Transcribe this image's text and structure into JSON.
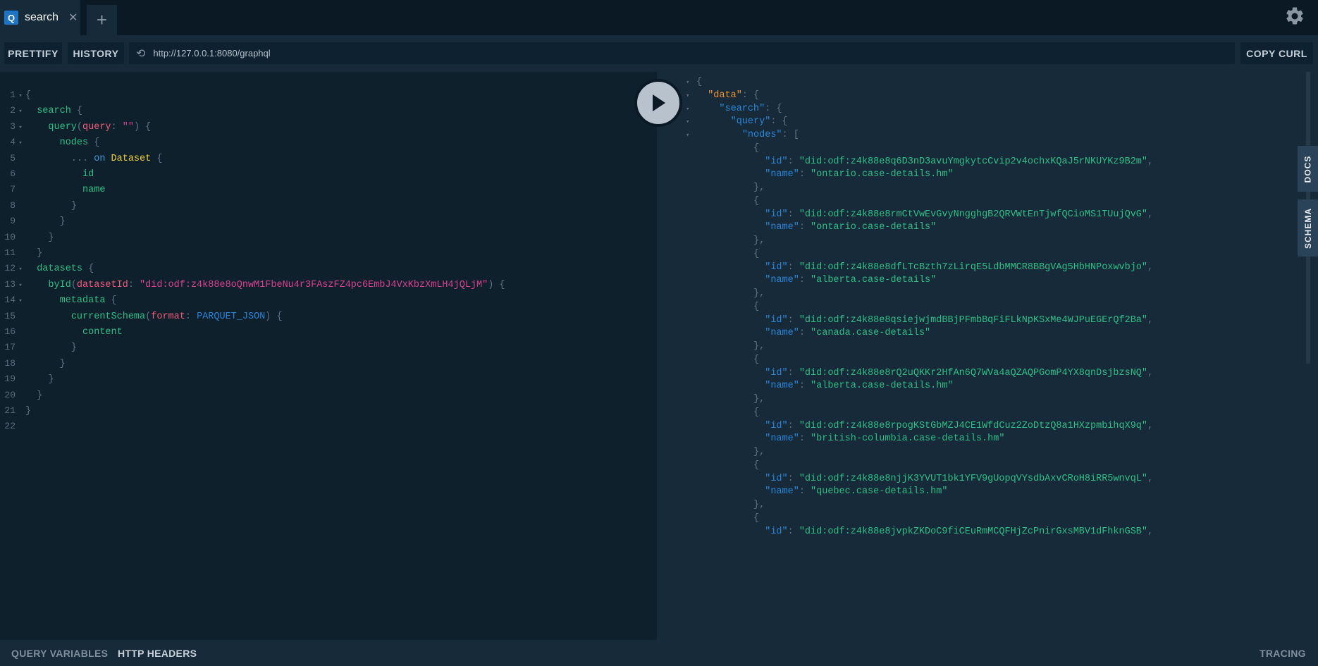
{
  "tabs": [
    {
      "icon_letter": "Q",
      "title": "search"
    }
  ],
  "toolbar": {
    "prettify": "PRETTIFY",
    "history": "HISTORY",
    "url": "http://127.0.0.1:8080/graphql",
    "copy_curl": "COPY CURL"
  },
  "side_tabs": {
    "docs": "DOCS",
    "schema": "SCHEMA"
  },
  "footer": {
    "query_variables": "QUERY VARIABLES",
    "http_headers": "HTTP HEADERS",
    "tracing": "TRACING"
  },
  "query_lines": [
    {
      "n": "1",
      "fold": true,
      "tokens": [
        [
          "p",
          "{"
        ]
      ]
    },
    {
      "n": "2",
      "fold": true,
      "tokens": [
        [
          "sp",
          "  "
        ],
        [
          "f",
          "search"
        ],
        [
          "p",
          " {"
        ]
      ]
    },
    {
      "n": "3",
      "fold": true,
      "tokens": [
        [
          "sp",
          "    "
        ],
        [
          "f",
          "query"
        ],
        [
          "p",
          "("
        ],
        [
          "a",
          "query"
        ],
        [
          "p",
          ": "
        ],
        [
          "s",
          "\"\""
        ],
        [
          "p",
          ") {"
        ]
      ]
    },
    {
      "n": "4",
      "fold": true,
      "tokens": [
        [
          "sp",
          "      "
        ],
        [
          "f",
          "nodes"
        ],
        [
          "p",
          " {"
        ]
      ]
    },
    {
      "n": "5",
      "fold": false,
      "tokens": [
        [
          "sp",
          "        "
        ],
        [
          "p",
          "... "
        ],
        [
          "k",
          "on"
        ],
        [
          "p",
          " "
        ],
        [
          "t",
          "Dataset"
        ],
        [
          "p",
          " {"
        ]
      ]
    },
    {
      "n": "6",
      "fold": false,
      "tokens": [
        [
          "sp",
          "          "
        ],
        [
          "f",
          "id"
        ]
      ]
    },
    {
      "n": "7",
      "fold": false,
      "tokens": [
        [
          "sp",
          "          "
        ],
        [
          "f",
          "name"
        ]
      ]
    },
    {
      "n": "8",
      "fold": false,
      "tokens": [
        [
          "sp",
          "        "
        ],
        [
          "p",
          "}"
        ]
      ]
    },
    {
      "n": "9",
      "fold": false,
      "tokens": [
        [
          "sp",
          "      "
        ],
        [
          "p",
          "}"
        ]
      ]
    },
    {
      "n": "10",
      "fold": false,
      "tokens": [
        [
          "sp",
          "    "
        ],
        [
          "p",
          "}"
        ]
      ]
    },
    {
      "n": "11",
      "fold": false,
      "tokens": [
        [
          "sp",
          "  "
        ],
        [
          "p",
          "}"
        ]
      ]
    },
    {
      "n": "12",
      "fold": true,
      "tokens": [
        [
          "sp",
          "  "
        ],
        [
          "f",
          "datasets"
        ],
        [
          "p",
          " {"
        ]
      ]
    },
    {
      "n": "13",
      "fold": true,
      "tokens": [
        [
          "sp",
          "    "
        ],
        [
          "f",
          "byId"
        ],
        [
          "p",
          "("
        ],
        [
          "a",
          "datasetId"
        ],
        [
          "p",
          ": "
        ],
        [
          "s",
          "\"did:odf:z4k88e8oQnwM1FbeNu4r3FAszFZ4pc6EmbJ4VxKbzXmLH4jQLjM\""
        ],
        [
          "p",
          ") {"
        ]
      ]
    },
    {
      "n": "14",
      "fold": true,
      "tokens": [
        [
          "sp",
          "      "
        ],
        [
          "f",
          "metadata"
        ],
        [
          "p",
          " {"
        ]
      ]
    },
    {
      "n": "15",
      "fold": false,
      "tokens": [
        [
          "sp",
          "        "
        ],
        [
          "f",
          "currentSchema"
        ],
        [
          "p",
          "("
        ],
        [
          "a",
          "format"
        ],
        [
          "p",
          ": "
        ],
        [
          "e",
          "PARQUET_JSON"
        ],
        [
          "p",
          ") {"
        ]
      ]
    },
    {
      "n": "16",
      "fold": false,
      "tokens": [
        [
          "sp",
          "          "
        ],
        [
          "f",
          "content"
        ]
      ]
    },
    {
      "n": "17",
      "fold": false,
      "tokens": [
        [
          "sp",
          "        "
        ],
        [
          "p",
          "}"
        ]
      ]
    },
    {
      "n": "18",
      "fold": false,
      "tokens": [
        [
          "sp",
          "      "
        ],
        [
          "p",
          "}"
        ]
      ]
    },
    {
      "n": "19",
      "fold": false,
      "tokens": [
        [
          "sp",
          "    "
        ],
        [
          "p",
          "}"
        ]
      ]
    },
    {
      "n": "20",
      "fold": false,
      "tokens": [
        [
          "sp",
          "  "
        ],
        [
          "p",
          "}"
        ]
      ]
    },
    {
      "n": "21",
      "fold": false,
      "tokens": [
        [
          "p",
          "}"
        ]
      ]
    },
    {
      "n": "22",
      "fold": false,
      "tokens": []
    }
  ],
  "result_lines": [
    {
      "fold": true,
      "tokens": [
        [
          "p",
          "{"
        ]
      ]
    },
    {
      "fold": true,
      "tokens": [
        [
          "sp",
          "  "
        ],
        [
          "dkey",
          "\"data\""
        ],
        [
          "p",
          ": {"
        ]
      ]
    },
    {
      "fold": true,
      "tokens": [
        [
          "sp",
          "    "
        ],
        [
          "key",
          "\"search\""
        ],
        [
          "p",
          ": {"
        ]
      ]
    },
    {
      "fold": true,
      "tokens": [
        [
          "sp",
          "      "
        ],
        [
          "key",
          "\"query\""
        ],
        [
          "p",
          ": {"
        ]
      ]
    },
    {
      "fold": true,
      "tokens": [
        [
          "sp",
          "        "
        ],
        [
          "key",
          "\"nodes\""
        ],
        [
          "p",
          ": ["
        ]
      ]
    },
    {
      "fold": false,
      "tokens": [
        [
          "sp",
          "          "
        ],
        [
          "p",
          "{"
        ]
      ]
    },
    {
      "fold": false,
      "tokens": [
        [
          "sp",
          "            "
        ],
        [
          "key",
          "\"id\""
        ],
        [
          "p",
          ": "
        ],
        [
          "str",
          "\"did:odf:z4k88e8q6D3nD3avuYmgkytcCvip2v4ochxKQaJ5rNKUYKz9B2m\""
        ],
        [
          "p",
          ","
        ]
      ]
    },
    {
      "fold": false,
      "tokens": [
        [
          "sp",
          "            "
        ],
        [
          "key",
          "\"name\""
        ],
        [
          "p",
          ": "
        ],
        [
          "str",
          "\"ontario.case-details.hm\""
        ]
      ]
    },
    {
      "fold": false,
      "tokens": [
        [
          "sp",
          "          "
        ],
        [
          "p",
          "},"
        ]
      ]
    },
    {
      "fold": false,
      "tokens": [
        [
          "sp",
          "          "
        ],
        [
          "p",
          "{"
        ]
      ]
    },
    {
      "fold": false,
      "tokens": [
        [
          "sp",
          "            "
        ],
        [
          "key",
          "\"id\""
        ],
        [
          "p",
          ": "
        ],
        [
          "str",
          "\"did:odf:z4k88e8rmCtVwEvGvyNngghgB2QRVWtEnTjwfQCioMS1TUujQvG\""
        ],
        [
          "p",
          ","
        ]
      ]
    },
    {
      "fold": false,
      "tokens": [
        [
          "sp",
          "            "
        ],
        [
          "key",
          "\"name\""
        ],
        [
          "p",
          ": "
        ],
        [
          "str",
          "\"ontario.case-details\""
        ]
      ]
    },
    {
      "fold": false,
      "tokens": [
        [
          "sp",
          "          "
        ],
        [
          "p",
          "},"
        ]
      ]
    },
    {
      "fold": false,
      "tokens": [
        [
          "sp",
          "          "
        ],
        [
          "p",
          "{"
        ]
      ]
    },
    {
      "fold": false,
      "tokens": [
        [
          "sp",
          "            "
        ],
        [
          "key",
          "\"id\""
        ],
        [
          "p",
          ": "
        ],
        [
          "str",
          "\"did:odf:z4k88e8dfLTcBzth7zLirqE5LdbMMCR8BBgVAg5HbHNPoxwvbjo\""
        ],
        [
          "p",
          ","
        ]
      ]
    },
    {
      "fold": false,
      "tokens": [
        [
          "sp",
          "            "
        ],
        [
          "key",
          "\"name\""
        ],
        [
          "p",
          ": "
        ],
        [
          "str",
          "\"alberta.case-details\""
        ]
      ]
    },
    {
      "fold": false,
      "tokens": [
        [
          "sp",
          "          "
        ],
        [
          "p",
          "},"
        ]
      ]
    },
    {
      "fold": false,
      "tokens": [
        [
          "sp",
          "          "
        ],
        [
          "p",
          "{"
        ]
      ]
    },
    {
      "fold": false,
      "tokens": [
        [
          "sp",
          "            "
        ],
        [
          "key",
          "\"id\""
        ],
        [
          "p",
          ": "
        ],
        [
          "str",
          "\"did:odf:z4k88e8qsiejwjmdBBjPFmbBqFiFLkNpKSxMe4WJPuEGErQf2Ba\""
        ],
        [
          "p",
          ","
        ]
      ]
    },
    {
      "fold": false,
      "tokens": [
        [
          "sp",
          "            "
        ],
        [
          "key",
          "\"name\""
        ],
        [
          "p",
          ": "
        ],
        [
          "str",
          "\"canada.case-details\""
        ]
      ]
    },
    {
      "fold": false,
      "tokens": [
        [
          "sp",
          "          "
        ],
        [
          "p",
          "},"
        ]
      ]
    },
    {
      "fold": false,
      "tokens": [
        [
          "sp",
          "          "
        ],
        [
          "p",
          "{"
        ]
      ]
    },
    {
      "fold": false,
      "tokens": [
        [
          "sp",
          "            "
        ],
        [
          "key",
          "\"id\""
        ],
        [
          "p",
          ": "
        ],
        [
          "str",
          "\"did:odf:z4k88e8rQ2uQKKr2HfAn6Q7WVa4aQZAQPGomP4YX8qnDsjbzsNQ\""
        ],
        [
          "p",
          ","
        ]
      ]
    },
    {
      "fold": false,
      "tokens": [
        [
          "sp",
          "            "
        ],
        [
          "key",
          "\"name\""
        ],
        [
          "p",
          ": "
        ],
        [
          "str",
          "\"alberta.case-details.hm\""
        ]
      ]
    },
    {
      "fold": false,
      "tokens": [
        [
          "sp",
          "          "
        ],
        [
          "p",
          "},"
        ]
      ]
    },
    {
      "fold": false,
      "tokens": [
        [
          "sp",
          "          "
        ],
        [
          "p",
          "{"
        ]
      ]
    },
    {
      "fold": false,
      "tokens": [
        [
          "sp",
          "            "
        ],
        [
          "key",
          "\"id\""
        ],
        [
          "p",
          ": "
        ],
        [
          "str",
          "\"did:odf:z4k88e8rpogKStGbMZJ4CE1WfdCuz2ZoDtzQ8a1HXzpmbihqX9q\""
        ],
        [
          "p",
          ","
        ]
      ]
    },
    {
      "fold": false,
      "tokens": [
        [
          "sp",
          "            "
        ],
        [
          "key",
          "\"name\""
        ],
        [
          "p",
          ": "
        ],
        [
          "str",
          "\"british-columbia.case-details.hm\""
        ]
      ]
    },
    {
      "fold": false,
      "tokens": [
        [
          "sp",
          "          "
        ],
        [
          "p",
          "},"
        ]
      ]
    },
    {
      "fold": false,
      "tokens": [
        [
          "sp",
          "          "
        ],
        [
          "p",
          "{"
        ]
      ]
    },
    {
      "fold": false,
      "tokens": [
        [
          "sp",
          "            "
        ],
        [
          "key",
          "\"id\""
        ],
        [
          "p",
          ": "
        ],
        [
          "str",
          "\"did:odf:z4k88e8njjK3YVUT1bk1YFV9gUopqVYsdbAxvCRoH8iRR5wnvqL\""
        ],
        [
          "p",
          ","
        ]
      ]
    },
    {
      "fold": false,
      "tokens": [
        [
          "sp",
          "            "
        ],
        [
          "key",
          "\"name\""
        ],
        [
          "p",
          ": "
        ],
        [
          "str",
          "\"quebec.case-details.hm\""
        ]
      ]
    },
    {
      "fold": false,
      "tokens": [
        [
          "sp",
          "          "
        ],
        [
          "p",
          "},"
        ]
      ]
    },
    {
      "fold": false,
      "tokens": [
        [
          "sp",
          "          "
        ],
        [
          "p",
          "{"
        ]
      ]
    },
    {
      "fold": false,
      "tokens": [
        [
          "sp",
          "            "
        ],
        [
          "key",
          "\"id\""
        ],
        [
          "p",
          ": "
        ],
        [
          "str",
          "\"did:odf:z4k88e8jvpkZKDoC9fiCEuRmMCQFHjZcPnirGxsMBV1dFhknGSB\""
        ],
        [
          "p",
          ","
        ]
      ]
    }
  ]
}
